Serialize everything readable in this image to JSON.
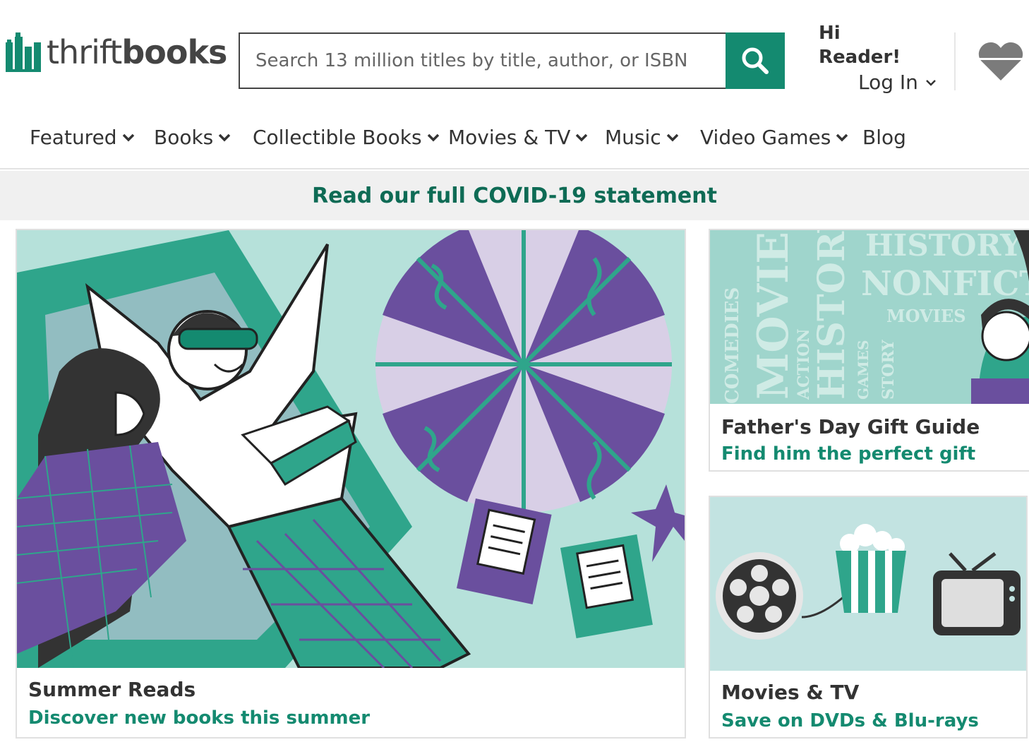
{
  "header": {
    "logo": {
      "text_light": "thrift",
      "text_bold": "books"
    },
    "search": {
      "placeholder": "Search 13 million titles by title, author, or ISBN",
      "icon": "search-icon"
    },
    "greeting_line1": "Hi",
    "greeting_line2": "Reader!",
    "login_label": "Log In",
    "wishlist_icon": "heart-icon"
  },
  "nav": {
    "items": [
      {
        "label": "Featured",
        "dropdown": true
      },
      {
        "label": "Books",
        "dropdown": true
      },
      {
        "label": "Collectible Books",
        "dropdown": true
      },
      {
        "label": "Movies & TV",
        "dropdown": true
      },
      {
        "label": "Music",
        "dropdown": true
      },
      {
        "label": "Video Games",
        "dropdown": true
      },
      {
        "label": "Blog",
        "dropdown": false
      }
    ]
  },
  "banner": {
    "text": "Read our full COVID-19 statement"
  },
  "cards": {
    "summer": {
      "title": "Summer Reads",
      "subtitle": "Discover new books this summer"
    },
    "fathers_day": {
      "title": "Father's Day Gift Guide",
      "subtitle": "Find him the perfect gift",
      "art_words": [
        "COMEDIES",
        "HISTORY",
        "NONFICTION",
        "MOVIES",
        "ACTION",
        "GAMES",
        "STORY"
      ]
    },
    "movies": {
      "title": "Movies & TV",
      "subtitle": "Save on DVDs & Blu-rays"
    }
  },
  "colors": {
    "brand_green": "#148a70",
    "dark_green": "#0e6b55",
    "mint": "#a8ddd4",
    "purple": "#6a4f9e",
    "lavender": "#d9d0e8"
  }
}
